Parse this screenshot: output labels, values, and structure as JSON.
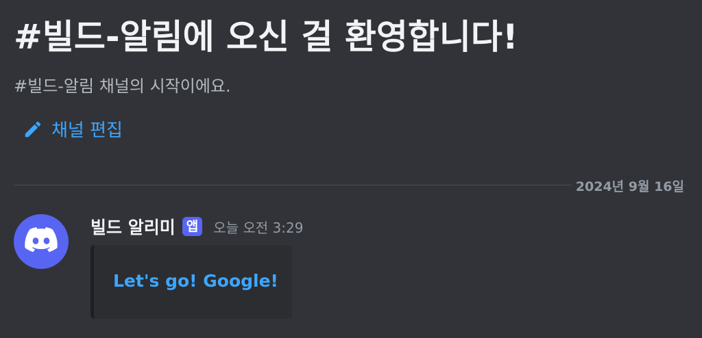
{
  "welcome": {
    "title": "#빌드-알림에 오신 걸 환영합니다!",
    "subtitle": "#빌드-알림 채널의 시작이에요.",
    "edit_channel_label": "채널 편집",
    "edit_icon": "pencil-icon"
  },
  "divider": {
    "date": "2024년 9월 16일"
  },
  "message": {
    "avatar_icon": "discord-logo-icon",
    "author": "빌드 알리미",
    "badge": "앱",
    "timestamp": "오늘 오전 3:29",
    "embed": {
      "link_text": "Let's go! Google!"
    }
  },
  "colors": {
    "background": "#313338",
    "link": "#3ea6ff",
    "badge": "#5865f2",
    "embed_background": "#2b2d31"
  }
}
